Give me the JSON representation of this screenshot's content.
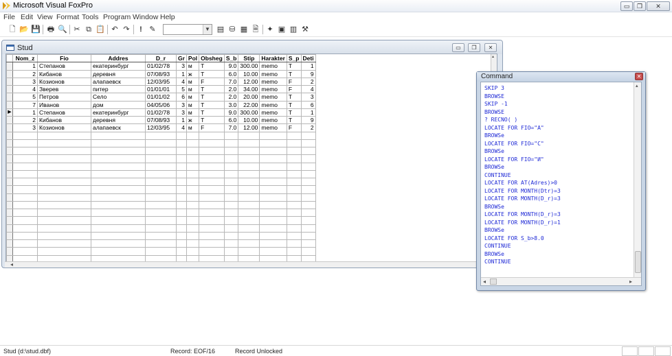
{
  "app": {
    "title": "Microsoft Visual FoxPro"
  },
  "window_controls": {
    "minimize": "▭",
    "restore": "❐",
    "close": "✕"
  },
  "menu": [
    "File",
    "Edit",
    "View",
    "Format",
    "Tools",
    "Program",
    "Window",
    "Help"
  ],
  "toolbar": {
    "buttons": [
      {
        "name": "new-icon",
        "glyph": "🗋"
      },
      {
        "name": "open-icon",
        "glyph": "📂"
      },
      {
        "name": "save-icon",
        "glyph": "💾"
      },
      {
        "name": "print-icon",
        "glyph": "🖶"
      },
      {
        "name": "print-preview-icon",
        "glyph": "🔍"
      },
      {
        "name": "cut-icon",
        "glyph": "✂"
      },
      {
        "name": "copy-icon",
        "glyph": "⧉"
      },
      {
        "name": "paste-icon",
        "glyph": "📋"
      },
      {
        "name": "undo-icon",
        "glyph": "↶"
      },
      {
        "name": "redo-icon",
        "glyph": "↷"
      },
      {
        "name": "run-icon",
        "glyph": "!"
      },
      {
        "name": "modify-form-icon",
        "glyph": "✎"
      },
      {
        "name": "command-window-icon",
        "glyph": "▤"
      },
      {
        "name": "data-session-icon",
        "glyph": "⛁"
      },
      {
        "name": "properties-icon",
        "glyph": "▦"
      },
      {
        "name": "code-icon",
        "glyph": "🗎"
      },
      {
        "name": "wizard-icon",
        "glyph": "✦"
      },
      {
        "name": "form-designer-icon",
        "glyph": "▣"
      },
      {
        "name": "report-designer-icon",
        "glyph": "▥"
      },
      {
        "name": "builder-icon",
        "glyph": "⚒"
      }
    ],
    "combo_value": "",
    "combo_arrow": "▼"
  },
  "stud_window": {
    "title": "Stud",
    "columns": [
      "Nom_z",
      "Fio",
      "Addres",
      "D_r",
      "Gr",
      "Pol",
      "Obsheg",
      "S_b",
      "Stip",
      "Harakter",
      "S_p",
      "Deti"
    ],
    "rows": [
      [
        "1",
        "Степанов",
        "екатеринбург",
        "01/02/78",
        "3",
        "м",
        "T",
        "9.0",
        "300.00",
        "memo",
        "T",
        "1"
      ],
      [
        "2",
        "Кибанов",
        "деревня",
        "07/08/93",
        "1",
        "ж",
        "T",
        "6.0",
        "10.00",
        "memo",
        "T",
        "9"
      ],
      [
        "3",
        "Козионов",
        "алапаевск",
        "12/03/95",
        "4",
        "м",
        "F",
        "7.0",
        "12.00",
        "memo",
        "F",
        "2"
      ],
      [
        "4",
        "Зверев",
        "питер",
        "01/01/01",
        "5",
        "м",
        "T",
        "2.0",
        "34.00",
        "memo",
        "F",
        "4"
      ],
      [
        "5",
        "Петров",
        "Село",
        "01/01/02",
        "6",
        "м",
        "T",
        "2.0",
        "20.00",
        "memo",
        "T",
        "3"
      ],
      [
        "7",
        "Иванов",
        "дом",
        "04/05/06",
        "3",
        "м",
        "T",
        "3.0",
        "22.00",
        "memo",
        "T",
        "6"
      ],
      [
        "1",
        "Степанов",
        "екатеринбург",
        "01/02/78",
        "3",
        "м",
        "T",
        "9.0",
        "300.00",
        "memo",
        "T",
        "1"
      ],
      [
        "2",
        "Кибанов",
        "деревня",
        "07/08/93",
        "1",
        "ж",
        "T",
        "6.0",
        "10.00",
        "memo",
        "T",
        "9"
      ],
      [
        "3",
        "Козионов",
        "алапаевск",
        "12/03/95",
        "4",
        "м",
        "F",
        "7.0",
        "12.00",
        "memo",
        "F",
        "2"
      ]
    ],
    "current_row_index": 6,
    "current_marker": "▶",
    "empty_rows": 17,
    "scroll_left": "◂",
    "scroll_up": "▴"
  },
  "command_window": {
    "title": "Command",
    "close": "✕",
    "lines": [
      "SKIP 3",
      "BROWSE",
      "SKIP -1",
      "BROWSE",
      "? RECNO( )",
      "LOCATE FOR FIO=\"A\"",
      "BROWSe",
      "LOCATE FOR FIO=\"C\"",
      "BROWSe",
      "LOCATE FOR FIO=\"И\"",
      "BROWSe",
      "CONTINUE",
      "LOCATE FOR AT(Adres)>0",
      "LOCATE FOR MONTH(Dtr)=3",
      "LOCATE FOR MONTH(D_r)=3",
      "BROWSe",
      "LOCATE FOR MONTH(D_r)=3",
      "LOCATE FOR MONTH(D_r)=1",
      "BROWSe",
      "LOCATE FOR S_b>8.0",
      "CONTINUE",
      "BROWSe",
      "CONTINUE"
    ],
    "scroll_up": "▴",
    "scroll_left": "◂",
    "scroll_right": "▸"
  },
  "status": {
    "file": "Stud (d:\\stud.dbf)",
    "record": "Record: EOF/16",
    "lock": "Record Unlocked"
  },
  "colors": {
    "command_text": "#1f2ad6",
    "title_gradient_top": "#fdfdfd"
  }
}
